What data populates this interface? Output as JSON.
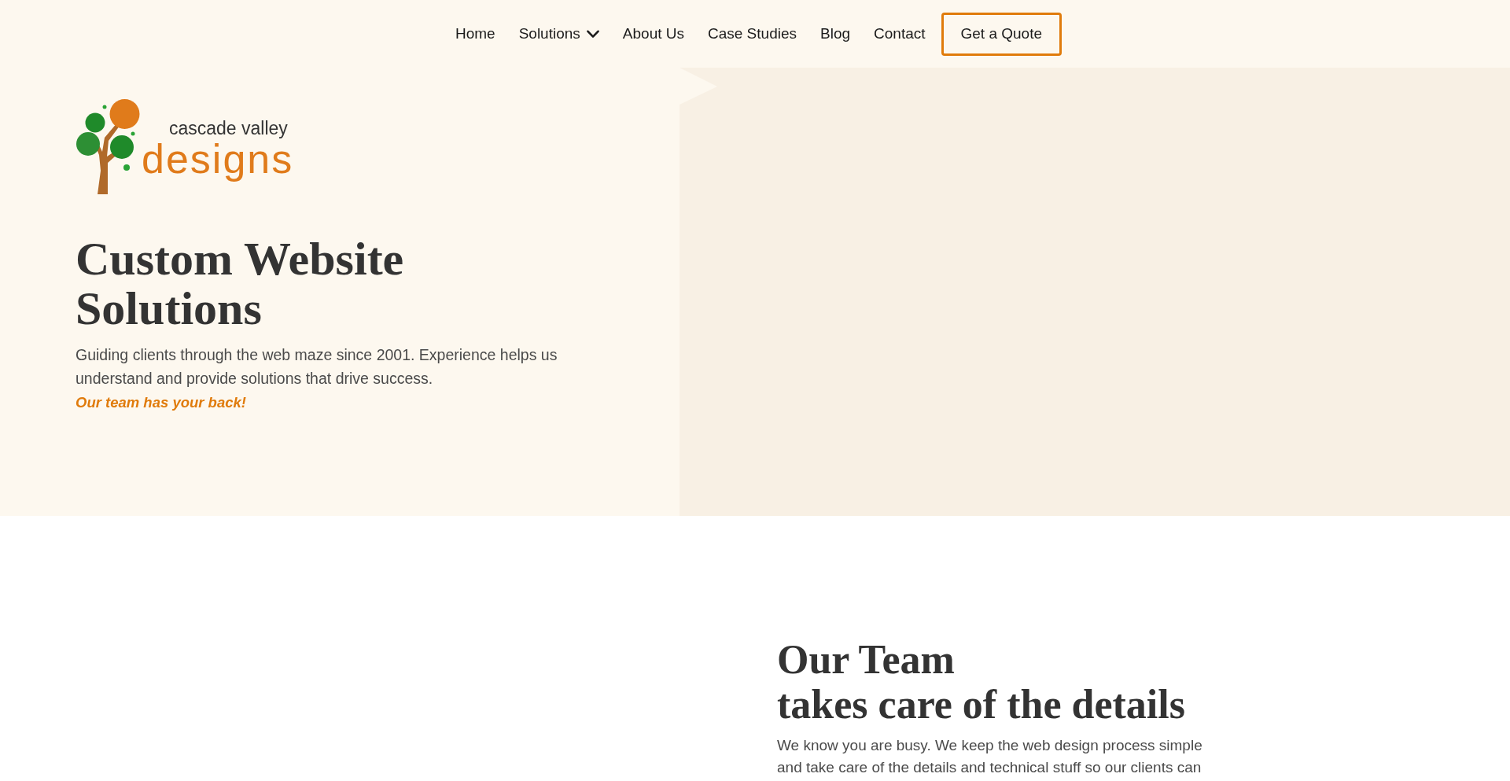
{
  "nav": {
    "items": [
      {
        "label": "Home",
        "kind": "link"
      },
      {
        "label": "Solutions",
        "kind": "dropdown"
      },
      {
        "label": "About Us",
        "kind": "link"
      },
      {
        "label": "Case Studies",
        "kind": "link"
      },
      {
        "label": "Blog",
        "kind": "link"
      },
      {
        "label": "Contact",
        "kind": "link"
      },
      {
        "label": "Get a Quote",
        "kind": "button"
      }
    ]
  },
  "hero": {
    "logo": {
      "line_1": "cascade valley",
      "line_2": "designs"
    },
    "title": "Custom Website Solutions",
    "text": "Guiding clients through the web maze since 2001. Experience helps us understand and provide solutions that drive success.",
    "tagline": "Our team has your back!"
  },
  "team_section": {
    "title_lines": [
      "Our Team",
      "takes care of the details"
    ],
    "text": "We know you are busy. We keep the web design process simple and take care of the details and technical stuff so our clients can"
  }
}
